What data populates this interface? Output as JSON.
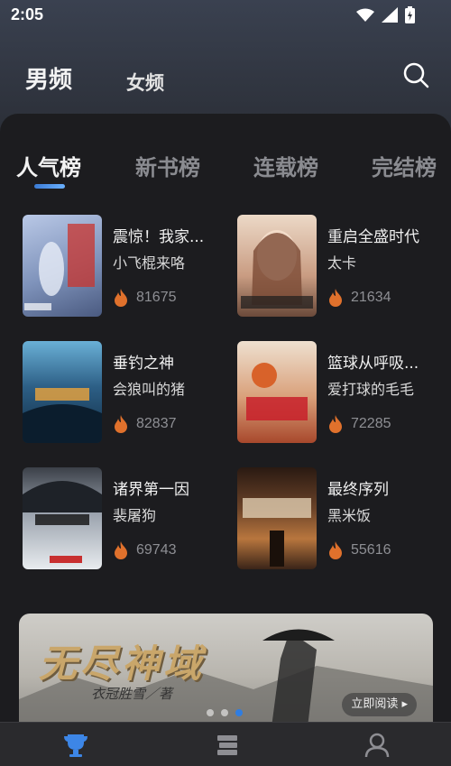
{
  "status": {
    "time": "2:05"
  },
  "nav": {
    "male_tab": "男频",
    "female_tab": "女频"
  },
  "rank_tabs": [
    "人气榜",
    "新书榜",
    "连载榜",
    "完结榜"
  ],
  "books": [
    {
      "title": "震惊！我家...",
      "author": "小飞棍来咯",
      "heat": "81675",
      "cover_color": "#8fa4c9"
    },
    {
      "title": "重启全盛时代",
      "author": "太卡",
      "heat": "21634",
      "cover_color": "#c89a82"
    },
    {
      "title": "垂钓之神",
      "author": "会狼叫的猪",
      "heat": "82837",
      "cover_color": "#2d5f86"
    },
    {
      "title": "篮球从呼吸...",
      "author": "爱打球的毛毛",
      "heat": "72285",
      "cover_color": "#d9a07a"
    },
    {
      "title": "诸界第一因",
      "author": "裴屠狗",
      "heat": "69743",
      "cover_color": "#9aa2ad"
    },
    {
      "title": "最终序列",
      "author": "黑米饭",
      "heat": "55616",
      "cover_color": "#6a4228"
    }
  ],
  "banner": {
    "title": "无尽神域",
    "subtitle": "衣冠胜雪／著",
    "button": "立即阅读 ▸"
  },
  "colors": {
    "accent": "#2f7de1",
    "heat": "#e0712c"
  }
}
